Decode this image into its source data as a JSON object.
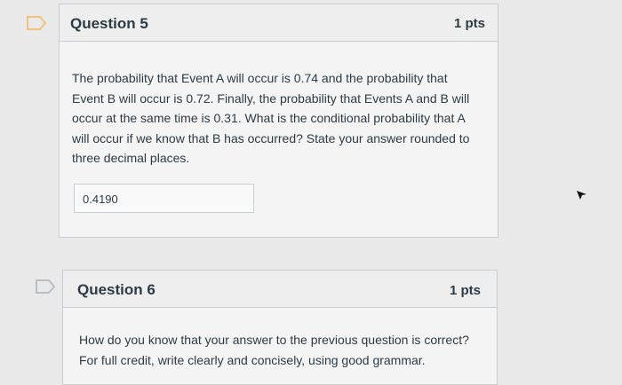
{
  "question5": {
    "title": "Question 5",
    "points": "1 pts",
    "text": "The probability that Event A will occur is 0.74 and the probability that Event B will occur is 0.72. Finally, the probability that Events A and B will occur at the same time is 0.31. What is the conditional probability that A will occur if we know that B has occurred? State your answer rounded to three decimal places.",
    "answer_value": "0.4190"
  },
  "question6": {
    "title": "Question 6",
    "points": "1 pts",
    "text": "How do you know that your answer to the previous question is correct? For full credit, write clearly and concisely, using good grammar."
  },
  "icons": {
    "flag": "bookmark-flag-icon",
    "cursor": "mouse-pointer-icon"
  },
  "colors": {
    "flag_active": "#f1c27d",
    "flag_inactive": "#b9bec3",
    "text": "#2d3b45",
    "border": "#c7cdd1"
  }
}
